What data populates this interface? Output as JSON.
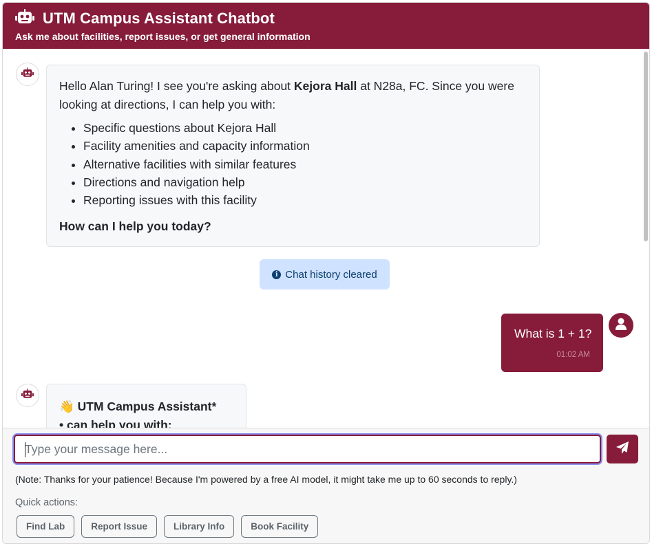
{
  "header": {
    "title": "UTM Campus Assistant Chatbot",
    "subtitle": "Ask me about facilities, report issues, or get general information"
  },
  "messages": {
    "bot1": {
      "greeting_start": "Hello Alan Turing! I see you're asking about ",
      "facility": "Kejora Hall",
      "greeting_end": " at N28a, FC. Since you were looking at directions, I can help you with:",
      "items": [
        "Specific questions about Kejora Hall",
        "Facility amenities and capacity information",
        "Alternative facilities with similar features",
        "Directions and navigation help",
        "Reporting issues with this facility"
      ],
      "closing": "How can I help you today?"
    },
    "system": {
      "text": "Chat history cleared",
      "icon": "info-icon"
    },
    "user1": {
      "text": "What is 1 + 1?",
      "time": "01:02 AM"
    },
    "bot2": {
      "line1_emoji": "👋",
      "line1": "UTM Campus Assistant*",
      "line2": "• can help you with:"
    }
  },
  "composer": {
    "placeholder": "Type your message here...",
    "send_icon": "paper-plane-icon"
  },
  "note": "(Note: Thanks for your patience! Because I'm powered by a free AI model, it might take me up to 60 seconds to reply.)",
  "quick_actions": {
    "label": "Quick actions:",
    "buttons": [
      "Find Lab",
      "Report Issue",
      "Library Info",
      "Book Facility"
    ]
  },
  "colors": {
    "brand": "#861c3a",
    "info_bg": "#cfe2ff",
    "bot_bubble_bg": "#f7f8fa"
  }
}
